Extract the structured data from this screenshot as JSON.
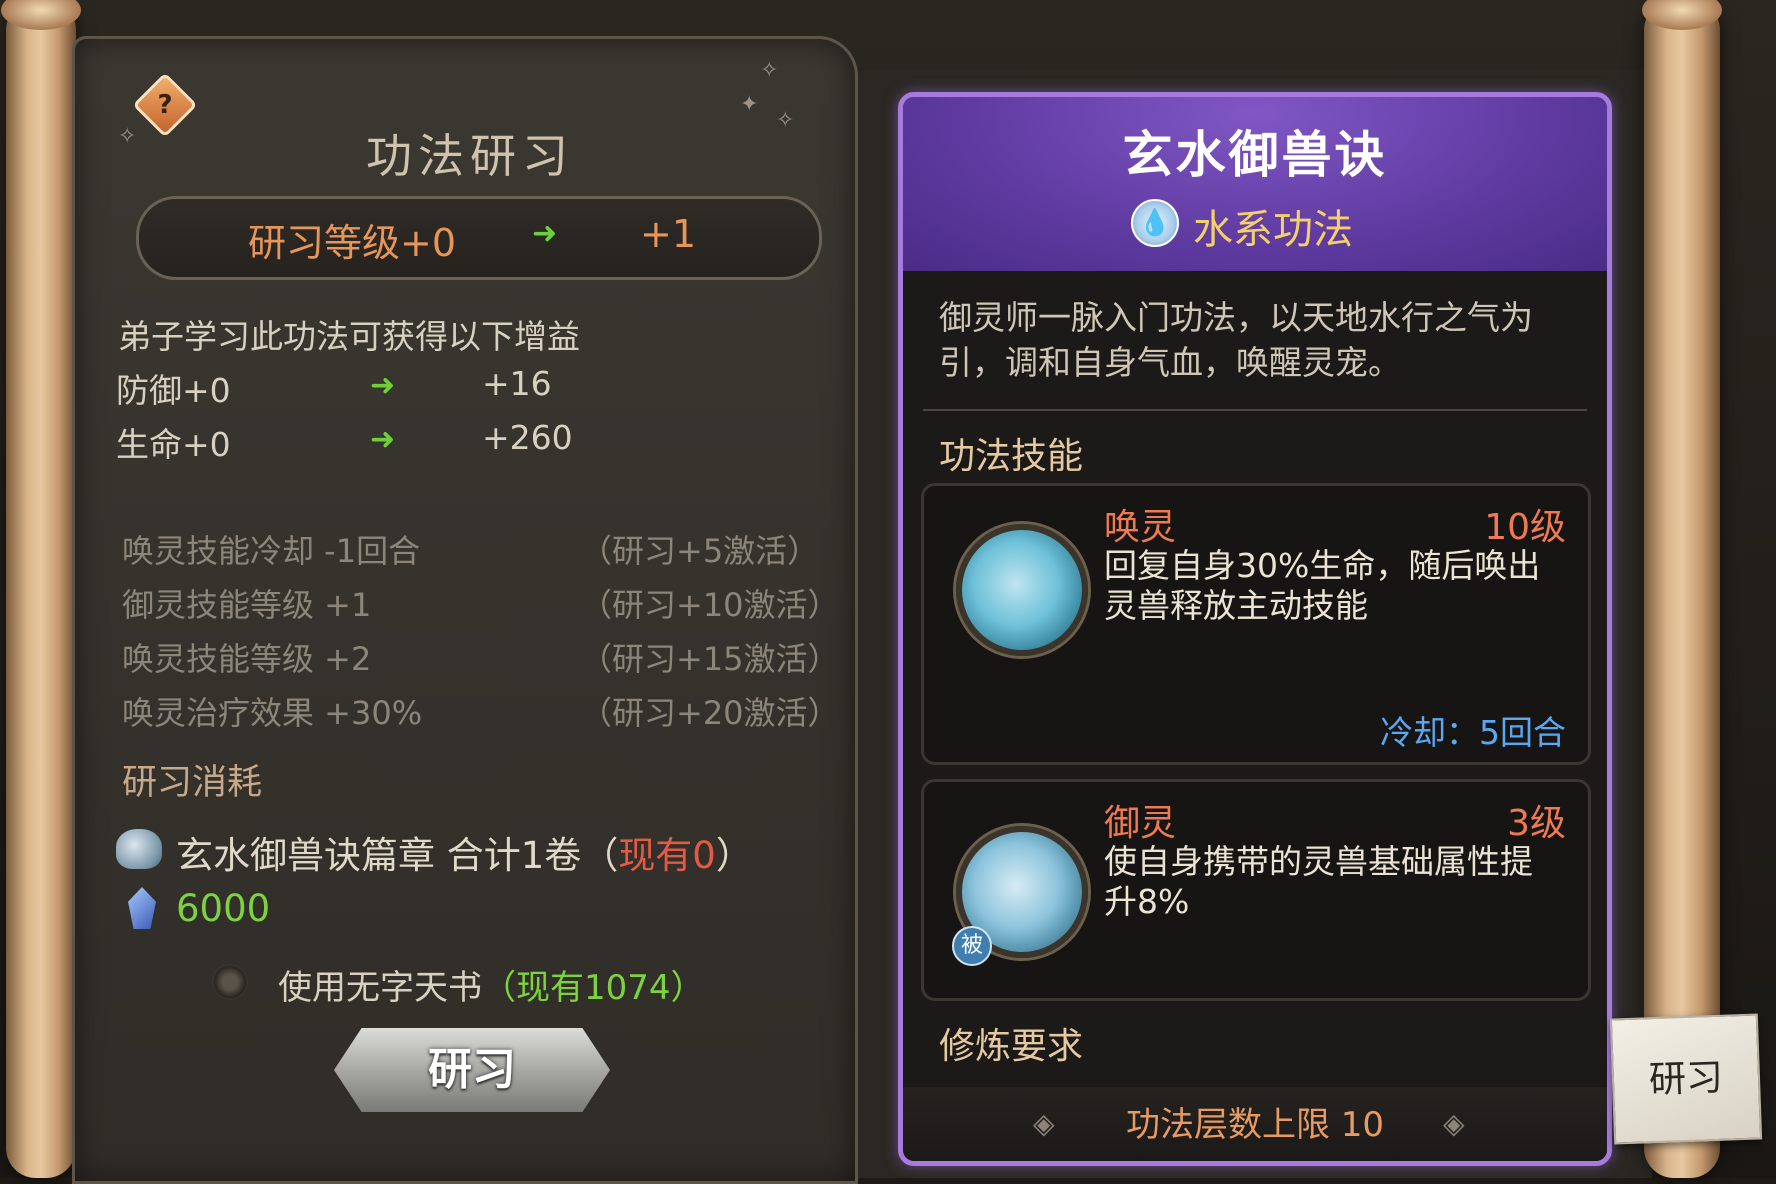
{
  "left_page": {
    "title": "功法研习",
    "level_from": "研习等级+0",
    "level_to": "+1",
    "gain_title": "弟子学习此功法可获得以下增益",
    "stats": [
      {
        "label": "防御+0",
        "to": "+16"
      },
      {
        "label": "生命+0",
        "to": "+260"
      }
    ],
    "activations": [
      {
        "effect": "唤灵技能冷却 -1回合",
        "condition": "（研习+5激活）"
      },
      {
        "effect": "御灵技能等级 +1",
        "condition": "（研习+10激活）"
      },
      {
        "effect": "唤灵技能等级 +2",
        "condition": "（研习+15激活）"
      },
      {
        "effect": "唤灵治疗效果 +30%",
        "condition": "（研习+20激活）"
      }
    ],
    "cost_title": "研习消耗",
    "cost_item": "玄水御兽诀篇章  合计1卷",
    "cost_owned_open": "（",
    "cost_owned": "现有0",
    "cost_owned_close": "）",
    "jade_cost": "6000",
    "use_book_label": "使用无字天书",
    "use_book_owned": "（现有1074）",
    "study_button": "研习"
  },
  "card": {
    "title": "玄水御兽诀",
    "element_label": "水系功法",
    "description": "御灵师一脉入门功法，以天地水行之气为引，调和自身气血，唤醒灵宠。",
    "skills_title": "功法技能",
    "skills": [
      {
        "name": "唤灵",
        "level": "10级",
        "desc": "回复自身30%生命，随后唤出灵兽释放主动技能",
        "cooldown": "冷却：5回合"
      },
      {
        "name": "御灵",
        "level": "3级",
        "desc": "使自身携带的灵兽基础属性提升8%",
        "tag": "被"
      }
    ],
    "req_title": "修炼要求",
    "layer_limit": "功法层数上限 10"
  },
  "side_button": "研习",
  "colors": {
    "accent_purple": "#a77ae0",
    "skill_name": "#ef7a52",
    "cooldown_blue": "#5aa7f2",
    "green": "#7dd23f",
    "red": "#e35a45"
  }
}
